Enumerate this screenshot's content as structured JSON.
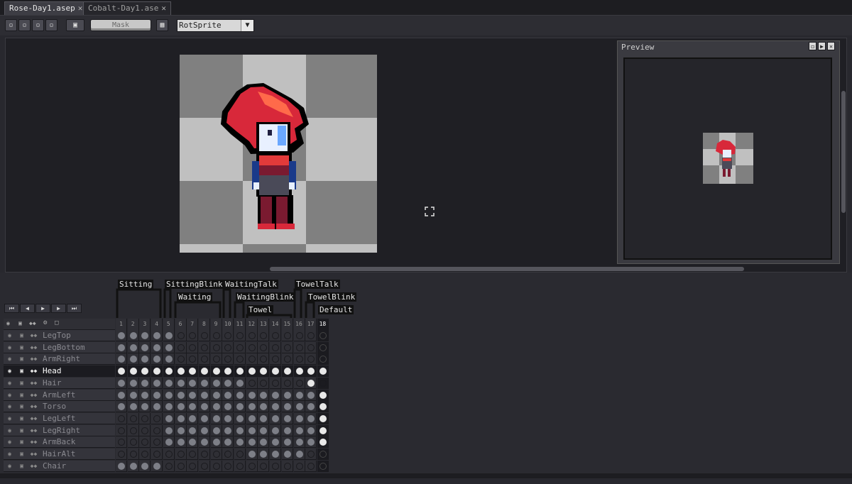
{
  "tabs": [
    {
      "label": "Rose-Day1.asep",
      "close": "✕",
      "active": true
    },
    {
      "label": "Cobalt-Day1.ase",
      "close": "✕",
      "active": false
    }
  ],
  "toolbar": {
    "mask_label": "Mask",
    "rotation_algorithm": "RotSprite",
    "dropdown_icon": "triangle-down-icon"
  },
  "preview": {
    "title": "Preview"
  },
  "tags": {
    "row1": [
      "Sitting",
      "SittingBlink",
      "WaitingTalk",
      "TowelTalk"
    ],
    "row2": [
      "Waiting",
      "WaitingBlink",
      "TowelBlink"
    ],
    "row3": [
      "Towel",
      "Default"
    ]
  },
  "frames": [
    "1",
    "2",
    "3",
    "4",
    "5",
    "6",
    "7",
    "8",
    "9",
    "10",
    "11",
    "12",
    "13",
    "14",
    "15",
    "16",
    "17",
    "18"
  ],
  "layers": [
    {
      "name": "LegTop",
      "cels": "11111000000000000e"
    },
    {
      "name": "LegBottom",
      "cels": "11111000000000000e"
    },
    {
      "name": "ArmRight",
      "cels": "11111000000000000e"
    },
    {
      "name": "Head",
      "cels": "11111111111111111f",
      "selected": true
    },
    {
      "name": "Hair",
      "cels": "1111111111100000f0"
    },
    {
      "name": "ArmLeft",
      "cels": "111111111111111111"
    },
    {
      "name": "Torso",
      "cels": "111111111111111111"
    },
    {
      "name": "LegLeft",
      "cels": "000011111111111111"
    },
    {
      "name": "LegRight",
      "cels": "000011111111111111"
    },
    {
      "name": "ArmBack",
      "cels": "000011111111111111"
    },
    {
      "name": "HairAlt",
      "cels": "00000000000111110e"
    },
    {
      "name": "Chair",
      "cels": "11110000000000000e"
    }
  ],
  "colors": {
    "accent": "#e8e8e8",
    "hair": "#d8283a",
    "skin": "#e8f0ff"
  }
}
